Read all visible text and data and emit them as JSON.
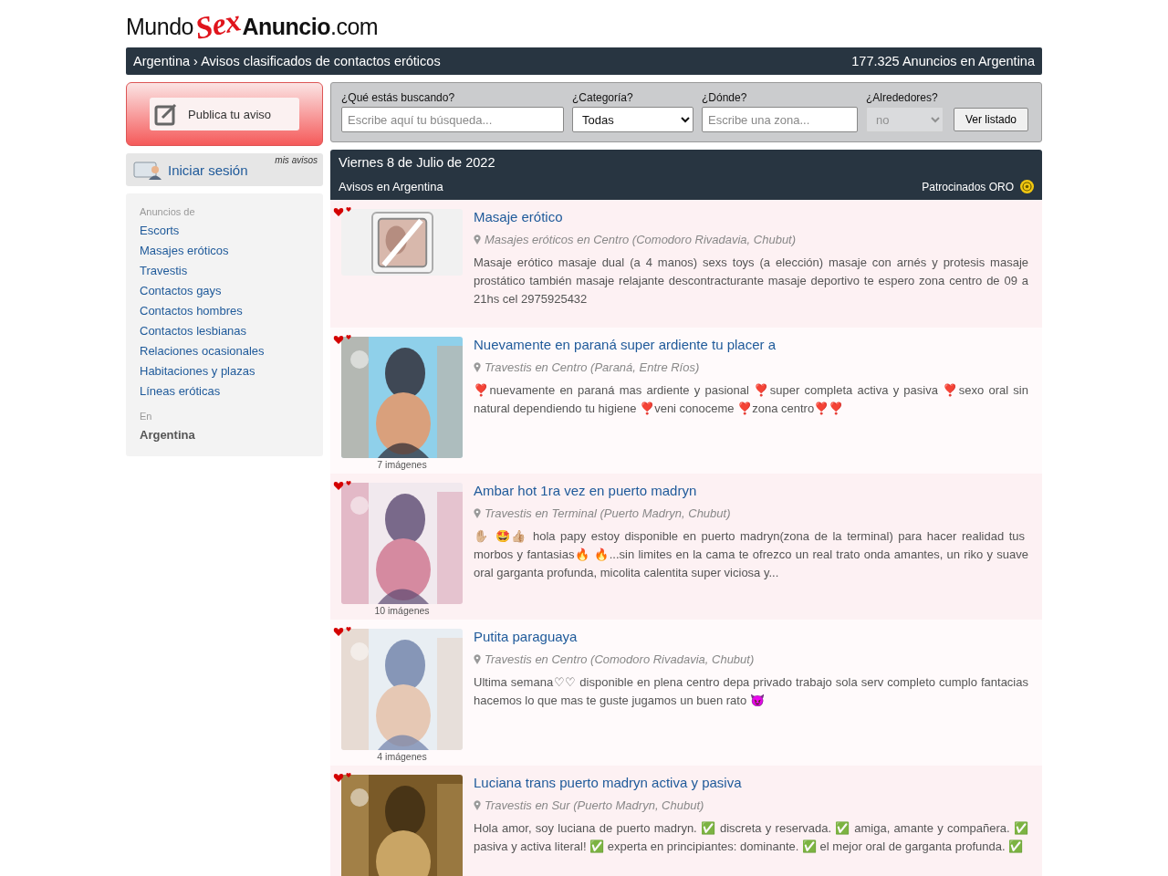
{
  "logo": {
    "part_1": "Mundo",
    "part_2": "Sex",
    "part_3": "Anuncio",
    "part_4": ".com"
  },
  "breadcrumb": {
    "country": "Argentina",
    "separator": "›",
    "title": "Avisos clasificados de contactos eróticos",
    "count": "177.325 Anuncios en Argentina"
  },
  "publish_button": "Publica tu aviso",
  "login": {
    "label": "Iniciar sesión",
    "my_ads": "mis avisos"
  },
  "sidebar": {
    "heading": "Anuncios de",
    "items": [
      "Escorts",
      "Masajes eróticos",
      "Travestis",
      "Contactos gays",
      "Contactos hombres",
      "Contactos lesbianas",
      "Relaciones ocasionales",
      "Habitaciones y plazas",
      "Líneas eróticas"
    ],
    "region_heading": "En",
    "region": "Argentina"
  },
  "search": {
    "query_label": "¿Qué estás buscando?",
    "query_placeholder": "Escribe aquí tu búsqueda...",
    "category_label": "¿Categoría?",
    "category_value": "Todas",
    "where_label": "¿Dónde?",
    "where_placeholder": "Escribe una zona...",
    "around_label": "¿Alrededores?",
    "around_value": "no",
    "around_disabled": true,
    "submit": "Ver listado"
  },
  "listing_header": {
    "date": "Viernes 8 de Julio de 2022",
    "subtitle": "Avisos en Argentina",
    "sponsored": "Patrocinados ORO"
  },
  "listings": [
    {
      "title": "Masaje erótico",
      "location": "Masajes eróticos en Centro (Comodoro Rivadavia, Chubut)",
      "text": "Masaje erótico masaje dual (a 4 manos) sexs toys (a elección) masaje con arnés y protesis masaje prostático también masaje relajante descontracturante masaje deportivo te espero zona centro de 09 a 21hs cel 2975925432",
      "kind": "no-photo"
    },
    {
      "title": "Nuevamente en paraná super ardiente tu placer a",
      "location": "Travestis en Centro (Paraná, Entre Ríos)",
      "text": "❣️nuevamente en paraná mas ardiente y pasional ❣️super completa activa y pasiva ❣️sexo oral sin natural dependiendo tu higiene ❣️veni conoceme ❣️zona centro❣️❣️",
      "images": "7 imágenes"
    },
    {
      "title": "Ambar hot 1ra vez en puerto madryn",
      "location": "Travestis en Terminal (Puerto Madryn, Chubut)",
      "text": "✋🏼 🤩👍🏼 hola papy estoy disponible en puerto madryn(zona de la terminal) para hacer realidad tus morbos y fantasias🔥 🔥...sin limites en la cama te ofrezco un real trato onda amantes, un riko y suave oral garganta profunda, micolita calentita super viciosa y...",
      "images": "10 imágenes"
    },
    {
      "title": "Putita paraguaya",
      "location": "Travestis en Centro (Comodoro Rivadavia, Chubut)",
      "text": "Ultima semana♡♡ disponible en plena centro depa privado trabajo sola serv completo cumplo fantacias hacemos lo que mas te guste jugamos un buen rato 😈",
      "images": "4 imágenes"
    },
    {
      "title": "Luciana trans puerto madryn activa y pasiva",
      "location": "Travestis en Sur (Puerto Madryn, Chubut)",
      "text": "Hola amor, soy luciana de puerto madryn. ✅ discreta y reservada. ✅ amiga, amante y compañera. ✅ pasiva y activa literal! ✅ experta en principiantes: dominante. ✅ el mejor oral de garganta profunda. ✅"
    }
  ]
}
